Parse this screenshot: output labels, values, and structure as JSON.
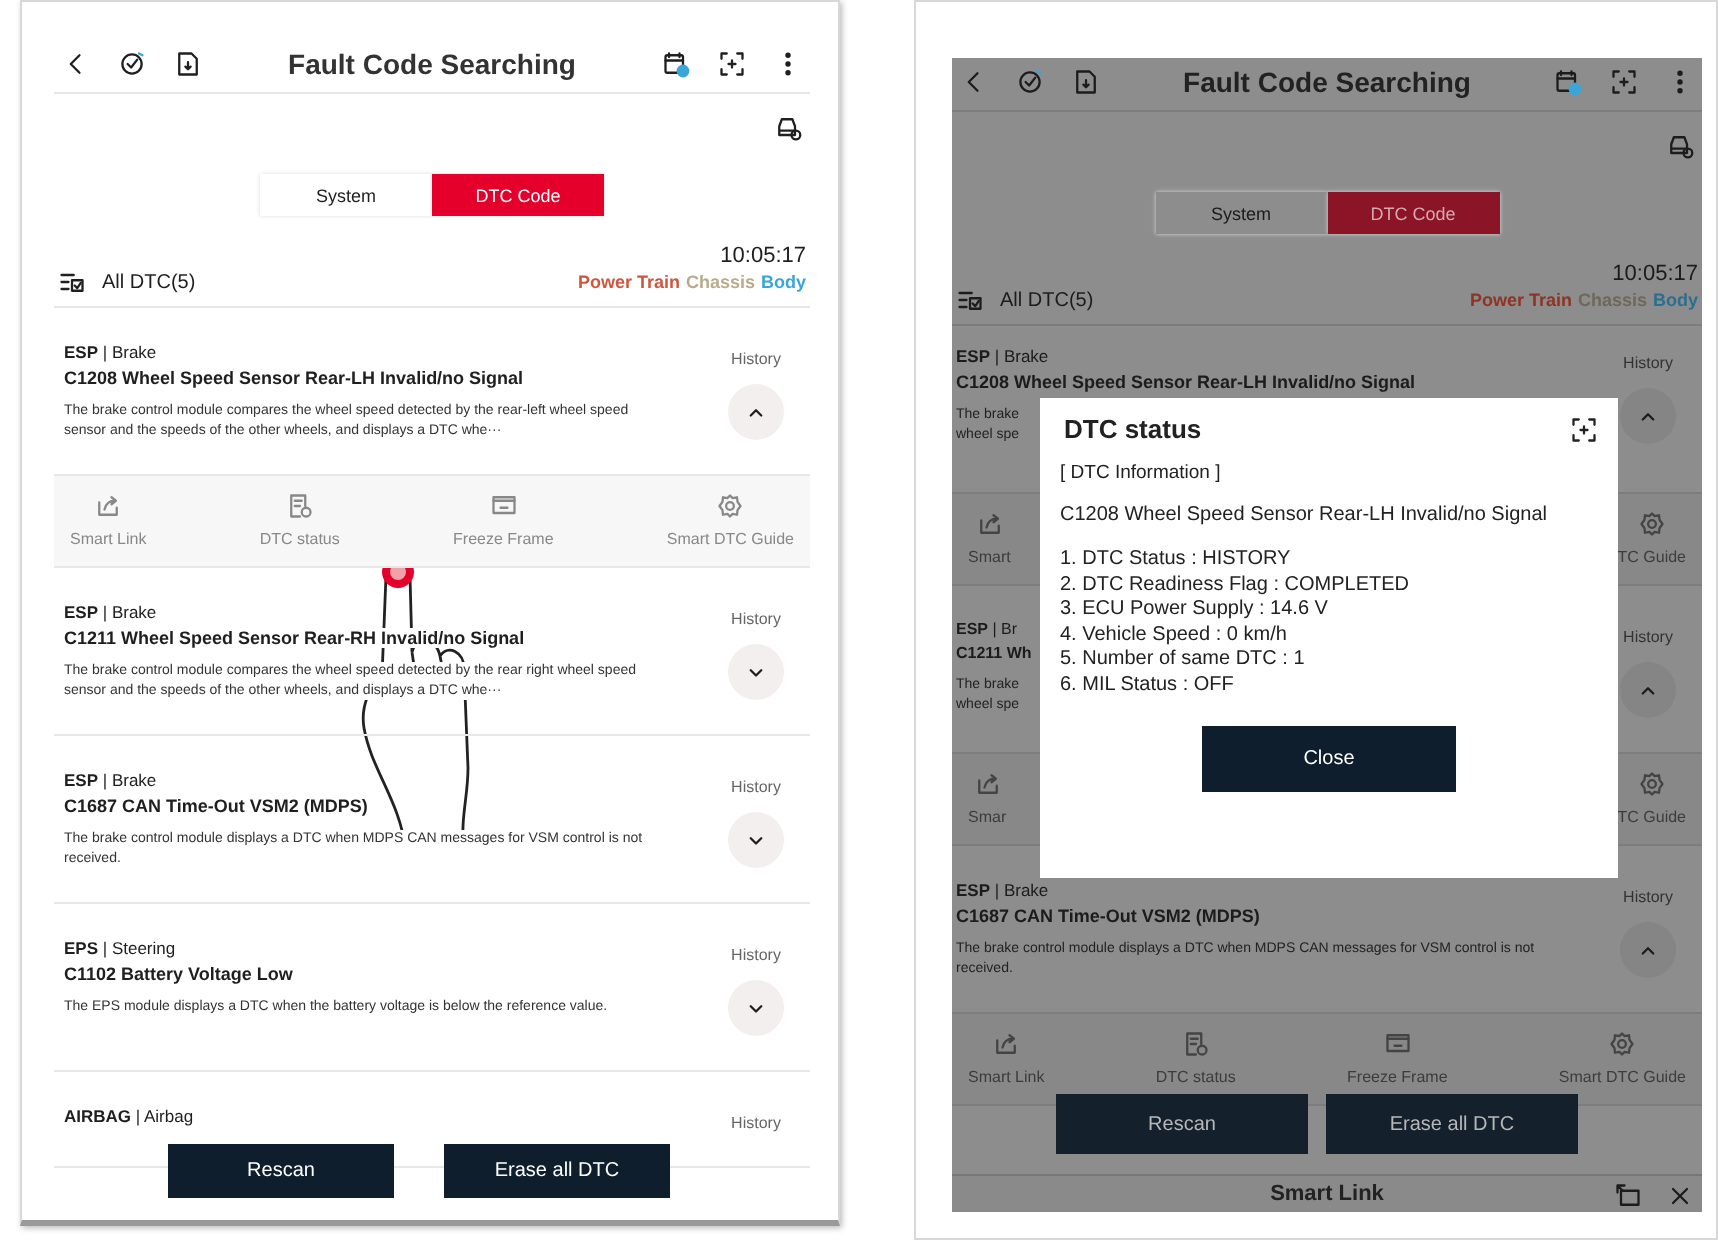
{
  "screens": [
    {
      "dimmed": false,
      "finger": true,
      "header": {
        "title": "Fault Code Searching"
      },
      "tabs": [
        {
          "label": "System",
          "selected": false
        },
        {
          "label": "DTC Code",
          "selected": true
        }
      ],
      "time": "10:05:17",
      "filter_label": "All DTC(5)",
      "legend": [
        {
          "label": "Power Train",
          "color": "#d0573f"
        },
        {
          "label": "Chassis",
          "color": "#b9ab8c"
        },
        {
          "label": "Body",
          "color": "#3aa6d8"
        }
      ],
      "items": [
        {
          "kind": "full",
          "heading": "**ESP** | Brake",
          "code": "C1208 Wheel Speed Sensor Rear-LH Invalid/no Signal",
          "desc": "The brake control module compares the wheel speed detected by the rear-left wheel speed sensor and the speeds of the other wheels, and displays a DTC whe···",
          "status": "History",
          "expanded": true,
          "actions": [
            {
              "kind": "share",
              "label": "Smart Link"
            },
            {
              "kind": "doc",
              "label": "DTC status"
            },
            {
              "kind": "frame",
              "label": "Freeze Frame"
            },
            {
              "kind": "gear",
              "label": "Smart DTC Guide"
            }
          ]
        },
        {
          "kind": "full",
          "heading": "**ESP** | Brake",
          "code": "C1211 Wheel Speed Sensor Rear-RH Invalid/no Signal",
          "desc": "The brake control module compares the wheel speed detected by the rear right wheel speed sensor and the speeds of the other wheels, and displays a DTC whe···",
          "status": "History",
          "expanded": false
        },
        {
          "kind": "full",
          "heading": "**ESP** | Brake",
          "code": "C1687 CAN Time-Out VSM2 (MDPS)",
          "desc": "The brake control module displays a DTC when MDPS CAN messages for VSM control is not received.",
          "status": "History",
          "expanded": false
        },
        {
          "kind": "full",
          "heading": "**EPS** | Steering",
          "code": "C1102 Battery Voltage Low",
          "desc": "The EPS module displays a DTC when the battery voltage is below the reference value.",
          "status": "History",
          "expanded": false
        },
        {
          "kind": "full",
          "heading": "**AIRBAG** | Airbag",
          "status": "History"
        }
      ],
      "buttons": [
        "Rescan",
        "Erase all DTC"
      ]
    },
    {
      "dimmed": true,
      "finger": false,
      "header": {
        "title": "Fault Code Searching"
      },
      "tabs": [
        {
          "label": "System",
          "selected": false
        },
        {
          "label": "DTC Code",
          "selected": true
        }
      ],
      "time": "10:05:17",
      "filter_label": "All DTC(5)",
      "legend": [
        {
          "label": "Power Train",
          "color": "#8e3424"
        },
        {
          "label": "Chassis",
          "color": "#6e6858"
        },
        {
          "label": "Body",
          "color": "#2b6f90"
        }
      ],
      "items": [
        {
          "kind": "desc_covered",
          "heading": "**ESP** | Brake",
          "code": "C1208 Wheel Speed Sensor Rear-LH Invalid/no Signal",
          "desc": "The brake wheel spe",
          "status": "History",
          "expanded": true,
          "actions": [
            {
              "kind": "share",
              "label": "Smart"
            },
            {
              "kind": "gear",
              "label": "TC Guide"
            }
          ]
        },
        {
          "kind": "covered",
          "heading": "**ESP** | Br",
          "code": "C1211 Wh",
          "desc": "The brake wheel spe",
          "status": "History",
          "expanded": true,
          "actions": [
            {
              "kind": "share",
              "label": "Smar"
            },
            {
              "kind": "gear",
              "label": "TC Guide"
            }
          ]
        },
        {
          "kind": "full",
          "heading": "**ESP** | Brake",
          "code": "C1687 CAN Time-Out VSM2 (MDPS)",
          "desc": "The brake control module displays a DTC when MDPS CAN messages for VSM control is not received.",
          "status": "History",
          "expanded": true,
          "actions": [
            {
              "kind": "share",
              "label": "Smart Link"
            },
            {
              "kind": "doc",
              "label": "DTC status"
            },
            {
              "kind": "frame",
              "label": "Freeze Frame"
            },
            {
              "kind": "gear",
              "label": "Smart DTC Guide"
            }
          ]
        }
      ],
      "buttons": [
        "Rescan",
        "Erase all DTC"
      ],
      "bottom_sheet": {
        "title": "Smart Link"
      },
      "dialog": {
        "title": "DTC status",
        "section": "[ DTC Information ]",
        "code_line": "C1208  Wheel Speed Sensor Rear-LH Invalid/no Signal",
        "lines": [
          "1. DTC Status : HISTORY",
          "2. DTC Readiness Flag : COMPLETED",
          "3. ECU Power Supply : 14.6 V",
          "4. Vehicle Speed : 0 km/h",
          "5. Number of same DTC : 1",
          "6. MIL Status : OFF"
        ],
        "button": "Close"
      }
    }
  ]
}
